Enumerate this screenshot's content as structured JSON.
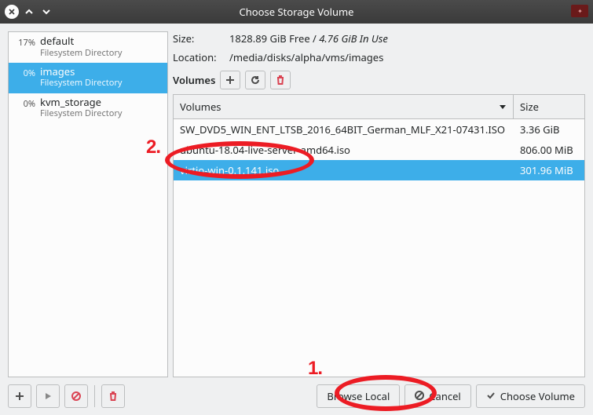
{
  "window": {
    "title": "Choose Storage Volume",
    "app_icon": "vm"
  },
  "sidebar": {
    "pools": [
      {
        "percent": "17%",
        "name": "default",
        "sub": "Filesystem Directory",
        "selected": false
      },
      {
        "percent": "0%",
        "name": "images",
        "sub": "Filesystem Directory",
        "selected": true
      },
      {
        "percent": "0%",
        "name": "kvm_storage",
        "sub": "Filesystem Directory",
        "selected": false
      }
    ]
  },
  "info": {
    "size_label": "Size:",
    "size_free": "1828.89 GiB Free",
    "size_sep": " / ",
    "size_used": "4.76 GiB In Use",
    "location_label": "Location:",
    "location_value": "/media/disks/alpha/vms/images"
  },
  "volumes_toolbar": {
    "label": "Volumes"
  },
  "volumes_table": {
    "col_name": "Volumes",
    "col_size": "Size",
    "rows": [
      {
        "name": "SW_DVD5_WIN_ENT_LTSB_2016_64BIT_German_MLF_X21-07431.ISO",
        "size": "3.36 GiB",
        "selected": false
      },
      {
        "name": "ubuntu-18.04-live-server-amd64.iso",
        "size": "806.00 MiB",
        "selected": false
      },
      {
        "name": "virtio-win-0.1.141.iso",
        "size": "301.96 MiB",
        "selected": true
      }
    ]
  },
  "buttons": {
    "browse_local": "Browse Local",
    "cancel": "Cancel",
    "choose_volume": "Choose Volume"
  },
  "annotations": {
    "num1": "1.",
    "num2": "2."
  }
}
